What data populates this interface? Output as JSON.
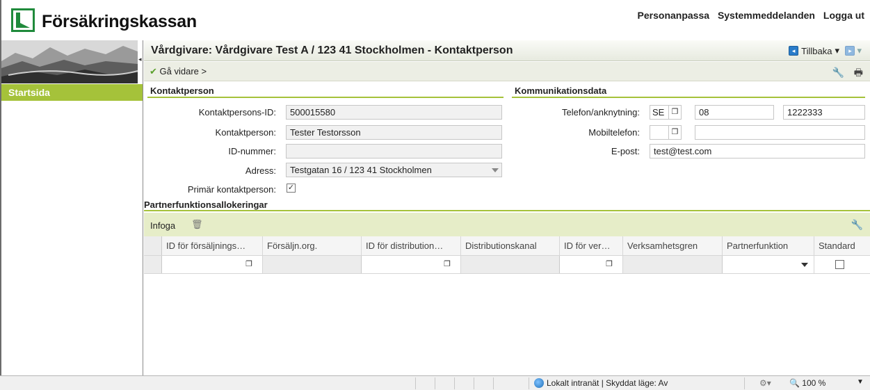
{
  "header": {
    "brand": "Försäkringskassan",
    "links": [
      "Personanpassa",
      "Systemmeddelanden",
      "Logga ut"
    ]
  },
  "nav": {
    "startsida": "Startsida"
  },
  "titlebar": {
    "title": "Vårdgivare: Vårdgivare Test A / 123 41 Stockholmen - Kontaktperson",
    "back": "Tillbaka",
    "back_arrow": "▾",
    "forward_arrow": "▾"
  },
  "toolbar": {
    "continue": "Gå vidare >"
  },
  "kontaktperson": {
    "heading": "Kontaktperson",
    "id_label": "Kontaktpersons-ID:",
    "id_value": "500015580",
    "name_label": "Kontaktperson:",
    "name_value": "Tester Testorsson",
    "idnr_label": "ID-nummer:",
    "idnr_value": "",
    "address_label": "Adress:",
    "address_value": "Testgatan 16 / 123 41 Stockholmen",
    "primary_label": "Primär kontaktperson:",
    "primary_checked": true
  },
  "kommunikation": {
    "heading": "Kommunikationsdata",
    "phone_label": "Telefon/anknytning:",
    "phone_country": "SE",
    "phone_area": "08",
    "phone_number": "1222333",
    "mobile_label": "Mobiltelefon:",
    "mobile_country": "",
    "mobile_number": "",
    "email_label": "E-post:",
    "email_value": "test@test.com"
  },
  "partner": {
    "heading": "Partnerfunktionsallokeringar",
    "insert": "Infoga",
    "columns": [
      "ID för försäljnings…",
      "Försäljn.org.",
      "ID för distribution…",
      "Distributionskanal",
      "ID för ver…",
      "Verksamhetsgren",
      "Partnerfunktion",
      "Standard"
    ]
  },
  "statusbar": {
    "zone": "Lokalt intranät | Skyddat läge: Av",
    "zoom": "100 %"
  },
  "colors": {
    "accent_green": "#a5c23a",
    "table_toolbar": "#e6edc8",
    "back_blue": "#2a7cc9"
  }
}
